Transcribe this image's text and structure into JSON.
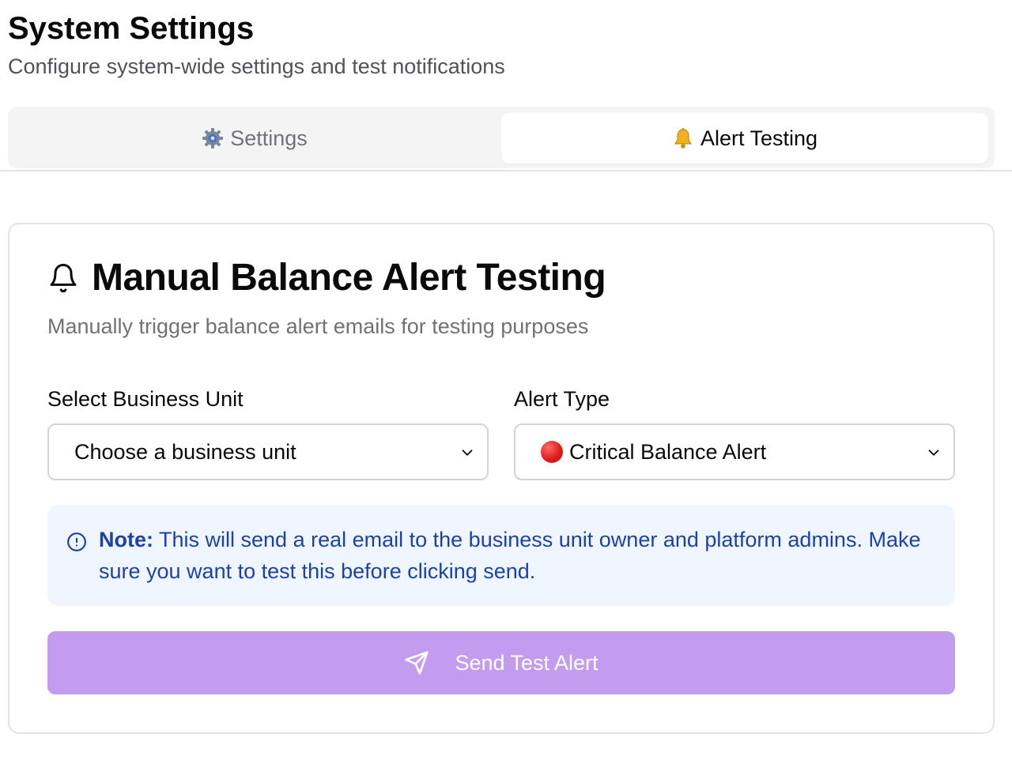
{
  "header": {
    "title": "System Settings",
    "subtitle": "Configure system-wide settings and test notifications"
  },
  "tabs": [
    {
      "label": "Settings",
      "icon": "gear-icon",
      "active": false
    },
    {
      "label": "Alert Testing",
      "icon": "bell-emoji-icon",
      "active": true
    }
  ],
  "card": {
    "title": "Manual Balance Alert Testing",
    "icon": "bell-icon",
    "description": "Manually trigger balance alert emails for testing purposes",
    "business_unit": {
      "label": "Select Business Unit",
      "value": "Choose a business unit"
    },
    "alert_type": {
      "label": "Alert Type",
      "value": "Critical Balance Alert",
      "value_icon": "red-circle-icon"
    },
    "note": {
      "prefix": "Note:",
      "text": " This will send a real email to the business unit owner and platform admins. Make sure you want to test this before clicking send."
    },
    "send_button": {
      "label": "Send Test Alert",
      "icon": "send-icon"
    }
  },
  "colors": {
    "accent_disabled": "#c39bef",
    "note_bg": "#eff6ff",
    "note_text": "#1e40af",
    "tab_bg": "#f4f4f5"
  }
}
